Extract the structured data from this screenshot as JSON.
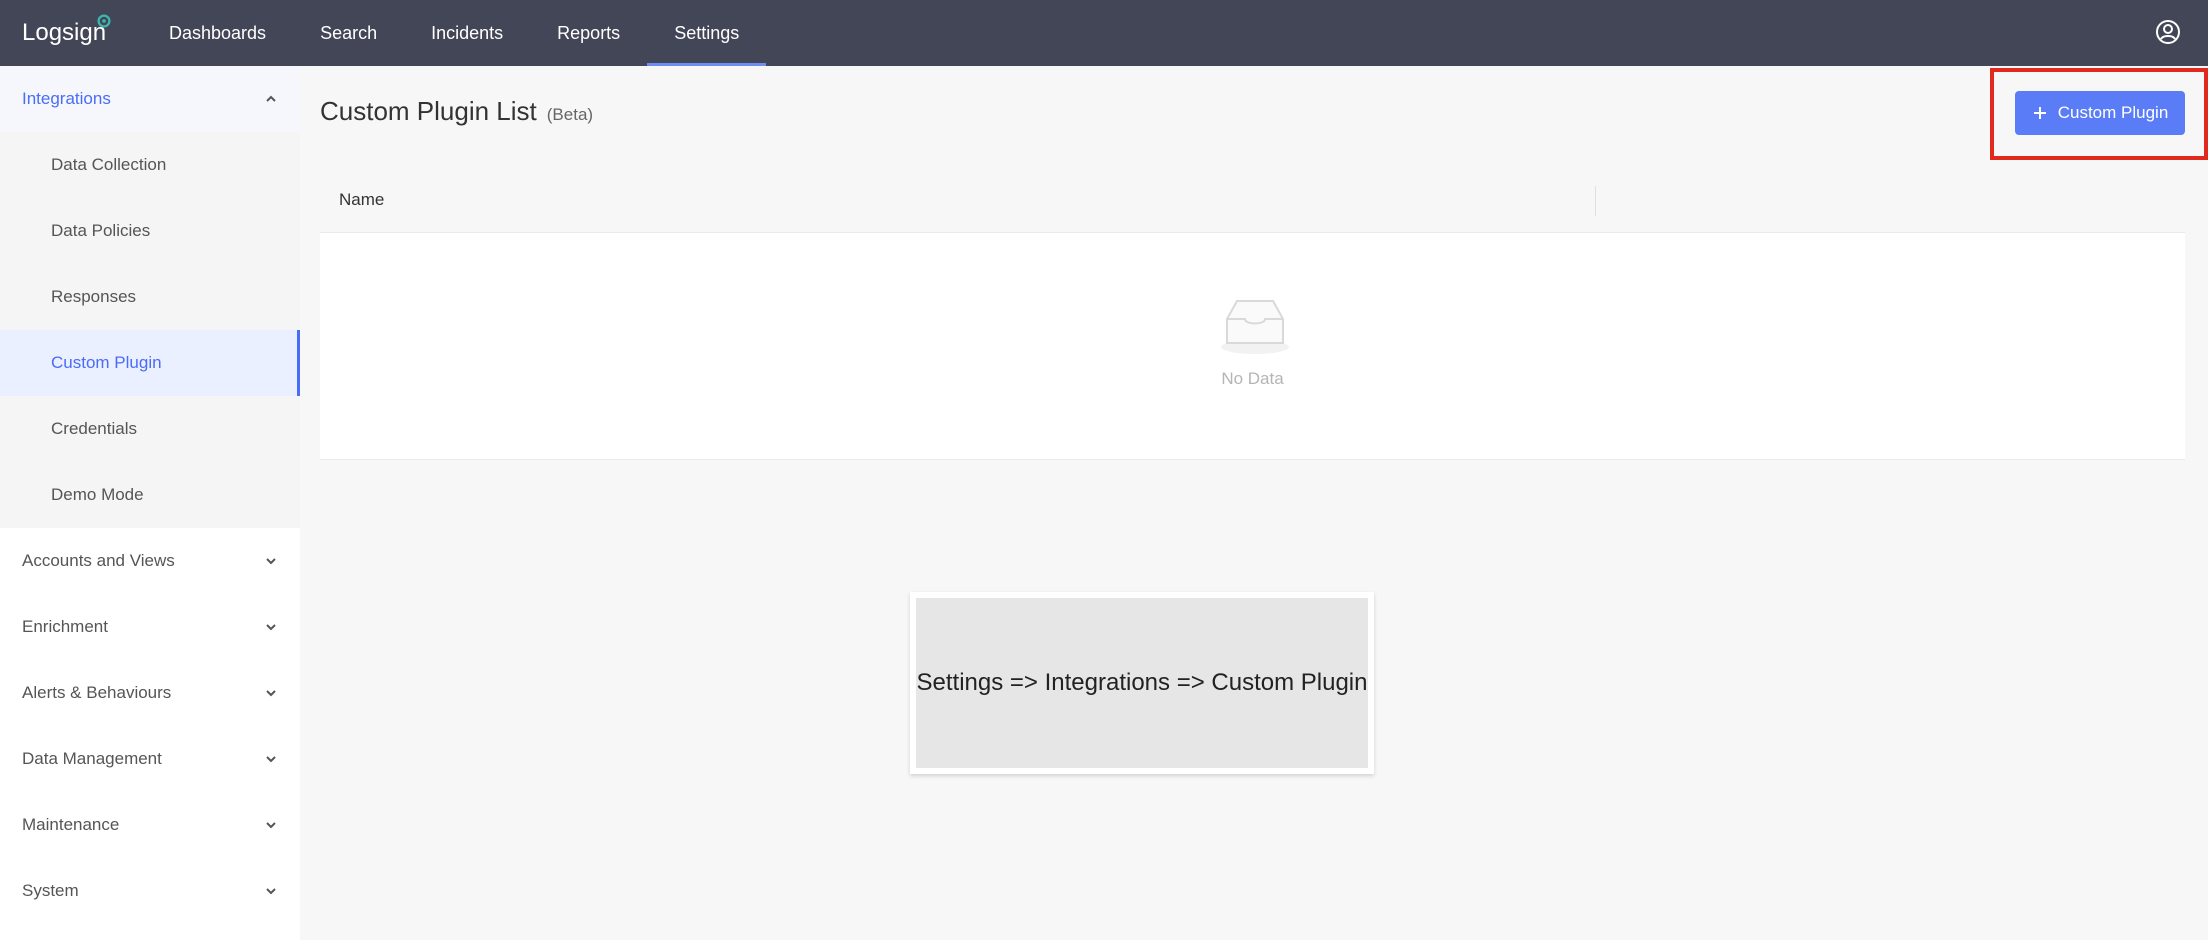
{
  "app": {
    "logo_text": "Logsign"
  },
  "nav": {
    "items": [
      {
        "label": "Dashboards"
      },
      {
        "label": "Search"
      },
      {
        "label": "Incidents"
      },
      {
        "label": "Reports"
      },
      {
        "label": "Settings"
      }
    ],
    "active": "Settings"
  },
  "sidebar": {
    "open_group": "Integrations",
    "sub_items": [
      {
        "label": "Data Collection"
      },
      {
        "label": "Data Policies"
      },
      {
        "label": "Responses"
      },
      {
        "label": "Custom Plugin"
      },
      {
        "label": "Credentials"
      },
      {
        "label": "Demo Mode"
      }
    ],
    "groups": [
      {
        "label": "Accounts and Views"
      },
      {
        "label": "Enrichment"
      },
      {
        "label": "Alerts & Behaviours"
      },
      {
        "label": "Data Management"
      },
      {
        "label": "Maintenance"
      },
      {
        "label": "System"
      }
    ]
  },
  "main": {
    "title": "Custom Plugin List",
    "badge": "(Beta)",
    "add_button_label": "Custom Plugin",
    "table": {
      "columns": [
        "Name"
      ],
      "empty_text": "No Data"
    },
    "caption": "Settings => Integrations => Custom Plugin"
  },
  "colors": {
    "nav_bg": "#434657",
    "accent": "#5b7cf7",
    "highlight": "#e12a1e"
  }
}
